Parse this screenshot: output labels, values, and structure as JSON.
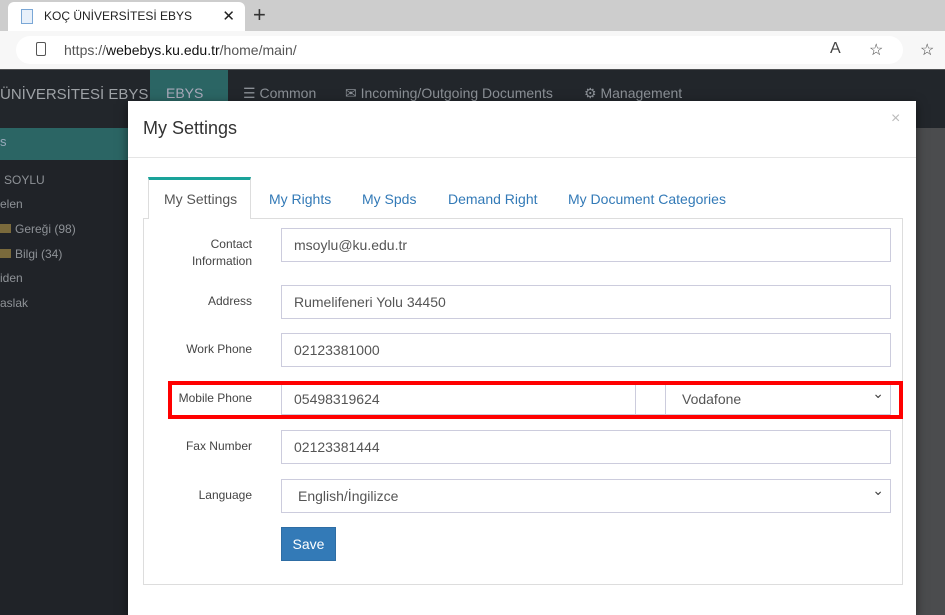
{
  "browser": {
    "tab_title": "KOÇ ÜNİVERSİTESİ EBYS",
    "url_scheme": "https://",
    "url_host": "webebys.ku.edu.tr",
    "url_path": "/home/main/"
  },
  "app": {
    "brand": "ÜNİVERSİTESİ EBYS",
    "nav": [
      "EBYS",
      "Common",
      "Incoming/Outgoing Documents",
      "Management"
    ],
    "sidebar": {
      "header": "s",
      "items": [
        "SOYLU",
        "elen",
        "Gereği (98)",
        "Bilgi (34)",
        "iden",
        "aslak"
      ]
    }
  },
  "modal": {
    "title": "My Settings",
    "close": "×",
    "tabs": [
      "My Settings",
      "My Rights",
      "My Spds",
      "Demand Right",
      "My Document Categories"
    ],
    "fields": {
      "contact_label": "Contact Information",
      "contact": "msoylu@ku.edu.tr",
      "address_label": "Address",
      "address": "Rumelifeneri Yolu 34450",
      "work_label": "Work Phone",
      "work": "02123381000",
      "mobile_label": "Mobile Phone",
      "mobile": "05498319624",
      "operator": "Vodafone",
      "fax_label": "Fax Number",
      "fax": "02123381444",
      "language_label": "Language",
      "language": "English/İngilizce"
    },
    "save": "Save"
  },
  "colors": {
    "accent": "#1aa39a",
    "primary": "#337ab7",
    "highlight": "#ff0000"
  }
}
